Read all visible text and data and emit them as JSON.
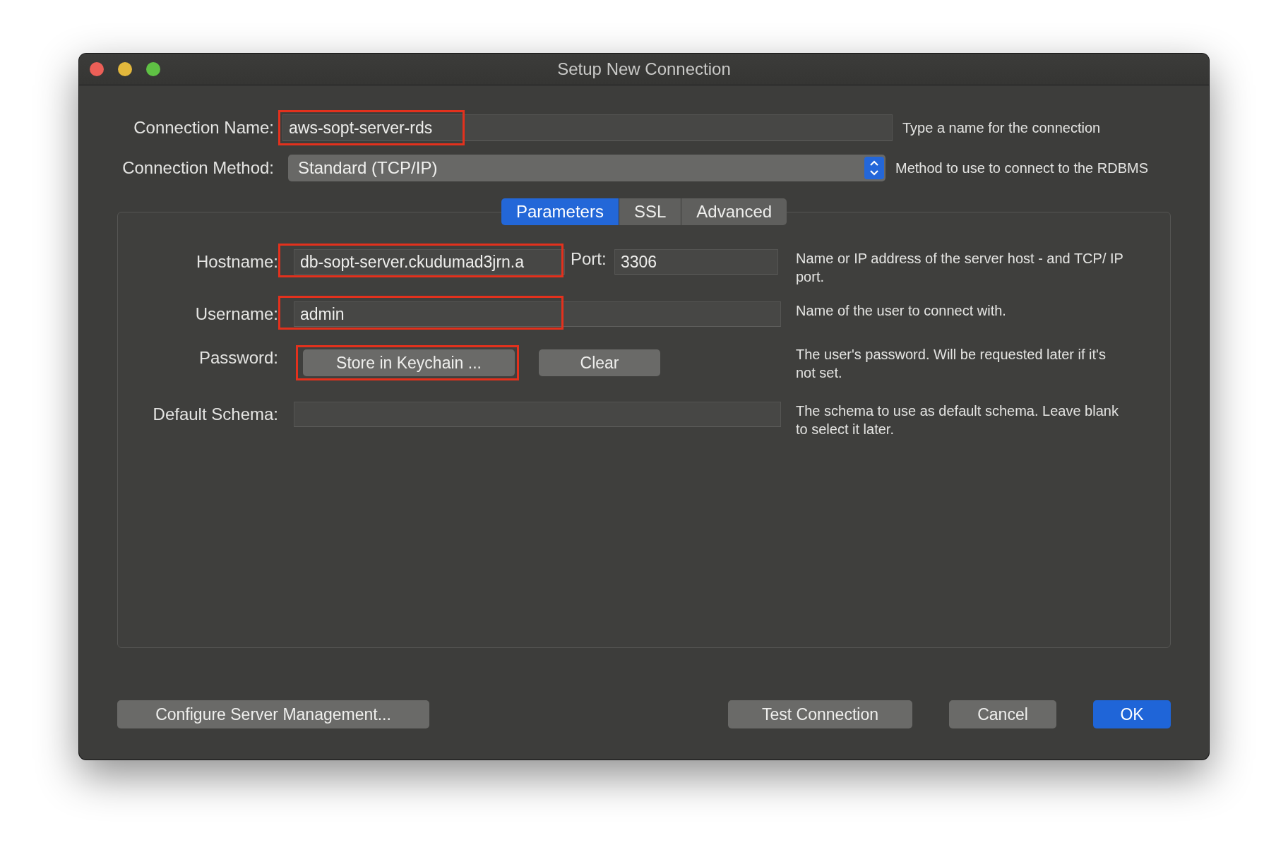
{
  "window": {
    "title": "Setup New Connection"
  },
  "connection_name": {
    "label": "Connection Name:",
    "value": "aws-sopt-server-rds",
    "highlighted": true,
    "help": "Type a name for the connection"
  },
  "connection_method": {
    "label": "Connection Method:",
    "value": "Standard (TCP/IP)",
    "help": "Method to use to connect to the RDBMS"
  },
  "tabs": [
    {
      "label": "Parameters",
      "selected": true
    },
    {
      "label": "SSL",
      "selected": false
    },
    {
      "label": "Advanced",
      "selected": false
    }
  ],
  "hostname": {
    "label": "Hostname:",
    "value": "db-sopt-server.ckudumad3jrn.a",
    "highlighted": true,
    "port_label": "Port:",
    "port_value": "3306",
    "help": "Name or IP address of the server host - and TCP/ IP port."
  },
  "username": {
    "label": "Username:",
    "value": "admin",
    "highlighted": true,
    "help": "Name of the user to connect with."
  },
  "password": {
    "label": "Password:",
    "buttons": [
      {
        "label": "Store in Keychain ...",
        "highlighted": true
      },
      {
        "label": "Clear",
        "highlighted": false
      }
    ],
    "help": "The user's password. Will be requested later if it's not set."
  },
  "default_schema": {
    "label": "Default Schema:",
    "help": "The schema to use as default schema. Leave blank to select it later."
  },
  "footer_buttons": [
    {
      "label": "Configure Server Management...",
      "kind": "normal"
    },
    {
      "label": "Test Connection",
      "kind": "normal"
    },
    {
      "label": "Cancel",
      "kind": "normal"
    },
    {
      "label": "OK",
      "kind": "default"
    }
  ]
}
